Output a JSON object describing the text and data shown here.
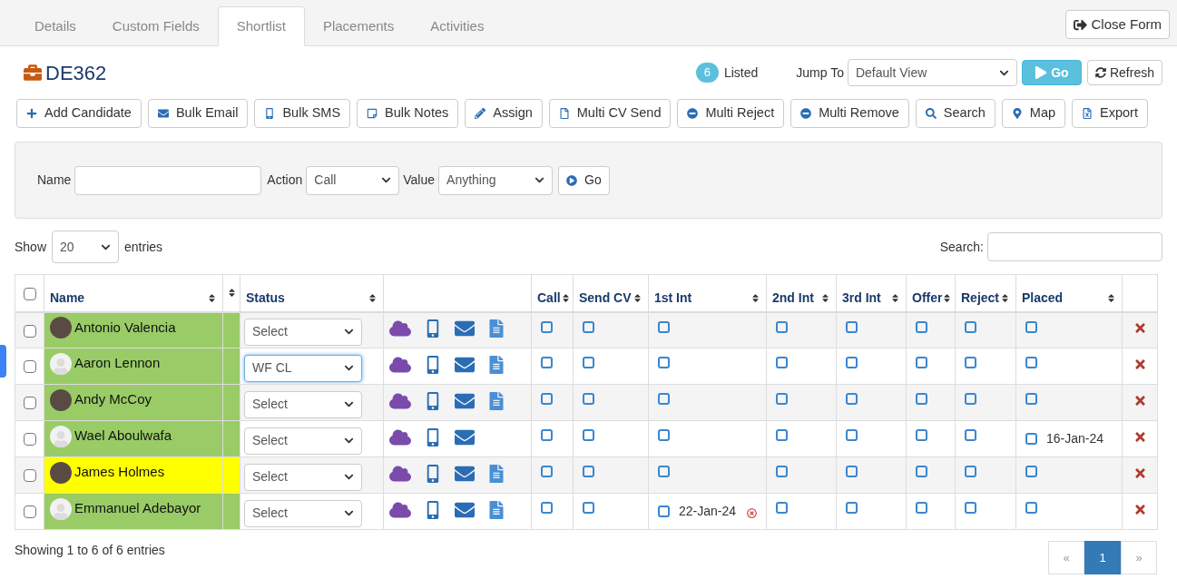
{
  "tabs": [
    {
      "label": "Details",
      "selected": false
    },
    {
      "label": "Custom Fields",
      "selected": false
    },
    {
      "label": "Shortlist",
      "selected": true
    },
    {
      "label": "Placements",
      "selected": false
    },
    {
      "label": "Activities",
      "selected": false
    }
  ],
  "close_button": "Close Form",
  "title": "DE362",
  "listed": {
    "count": "6",
    "label": "Listed"
  },
  "jump_to": {
    "label": "Jump To",
    "value": "Default View",
    "go": "Go",
    "refresh": "Refresh"
  },
  "toolbar": [
    {
      "kind": "plus",
      "label": "Add Candidate"
    },
    {
      "kind": "email",
      "label": "Bulk Email"
    },
    {
      "kind": "mobile",
      "label": "Bulk SMS"
    },
    {
      "kind": "note",
      "label": "Bulk Notes"
    },
    {
      "kind": "pencil",
      "label": "Assign"
    },
    {
      "kind": "file",
      "label": "Multi CV Send"
    },
    {
      "kind": "minus",
      "label": "Multi Reject"
    },
    {
      "kind": "minus",
      "label": "Multi Remove"
    },
    {
      "kind": "search",
      "label": "Search"
    },
    {
      "kind": "pin",
      "label": "Map"
    },
    {
      "kind": "excel",
      "label": "Export"
    }
  ],
  "filter": {
    "name_label": "Name",
    "action_label": "Action",
    "action_value": "Call",
    "value_label": "Value",
    "value_value": "Anything",
    "go": "Go"
  },
  "show": {
    "label": "Show",
    "value": "20",
    "suffix": "entries"
  },
  "search_label": "Search:",
  "table": {
    "select_all_checked": false,
    "columns": [
      "Name",
      "Status",
      "Call",
      "Send CV",
      "1st Int",
      "2nd Int",
      "3rd Int",
      "Offer",
      "Reject",
      "Placed"
    ],
    "rows": [
      {
        "checked": false,
        "name": "Antonio Valencia",
        "color": "#99cc66",
        "avatar": {
          "kind": "photo"
        },
        "status": "Select",
        "status_focused": false,
        "cv": true,
        "stages": [
          {
            "checked": false
          },
          {
            "checked": false
          },
          {
            "checked": false
          },
          {
            "checked": false
          },
          {
            "checked": false
          },
          {
            "checked": false
          },
          {
            "checked": false
          },
          {
            "checked": false
          }
        ]
      },
      {
        "checked": false,
        "name": "Aaron Lennon",
        "color": "#99cc66",
        "avatar": {
          "kind": "silhouette"
        },
        "status": "WF CL",
        "status_focused": true,
        "cv": true,
        "stages": [
          {
            "checked": false
          },
          {
            "checked": false
          },
          {
            "checked": false
          },
          {
            "checked": false
          },
          {
            "checked": false
          },
          {
            "checked": false
          },
          {
            "checked": false
          },
          {
            "checked": false
          }
        ]
      },
      {
        "checked": false,
        "name": "Andy McCoy",
        "color": "#99cc66",
        "avatar": {
          "kind": "photo"
        },
        "status": "Select",
        "status_focused": false,
        "cv": true,
        "stages": [
          {
            "checked": false
          },
          {
            "checked": false
          },
          {
            "checked": false
          },
          {
            "checked": false
          },
          {
            "checked": false
          },
          {
            "checked": false
          },
          {
            "checked": false
          },
          {
            "checked": false
          }
        ]
      },
      {
        "checked": false,
        "name": "Wael Aboulwafa",
        "color": "#99cc66",
        "avatar": {
          "kind": "silhouette"
        },
        "status": "Select",
        "status_focused": false,
        "cv": false,
        "stages": [
          {
            "checked": false
          },
          {
            "checked": false
          },
          {
            "checked": false
          },
          {
            "checked": false
          },
          {
            "checked": false
          },
          {
            "checked": false
          },
          {
            "checked": false
          },
          {
            "checked": false,
            "date": "16-Jan-24"
          }
        ]
      },
      {
        "checked": false,
        "name": "James Holmes",
        "color": "#ffff00",
        "avatar": {
          "kind": "photo"
        },
        "status": "Select",
        "status_focused": false,
        "cv": true,
        "stages": [
          {
            "checked": false
          },
          {
            "checked": false
          },
          {
            "checked": false
          },
          {
            "checked": false
          },
          {
            "checked": false
          },
          {
            "checked": false
          },
          {
            "checked": false
          },
          {
            "checked": false
          }
        ]
      },
      {
        "checked": false,
        "name": "Emmanuel Adebayor",
        "color": "#99cc66",
        "avatar": {
          "kind": "silhouette"
        },
        "status": "Select",
        "status_focused": false,
        "cv": true,
        "stages": [
          {
            "checked": false
          },
          {
            "checked": false
          },
          {
            "checked": false,
            "date": "22-Jan-24",
            "clearable": true
          },
          {
            "checked": false
          },
          {
            "checked": false
          },
          {
            "checked": false
          },
          {
            "checked": false
          },
          {
            "checked": false
          }
        ]
      }
    ]
  },
  "footer": "Showing 1 to 6 of 6 entries",
  "pagination": [
    {
      "label": "«",
      "selected": false
    },
    {
      "label": "1",
      "selected": true
    },
    {
      "label": "»",
      "selected": false
    }
  ]
}
